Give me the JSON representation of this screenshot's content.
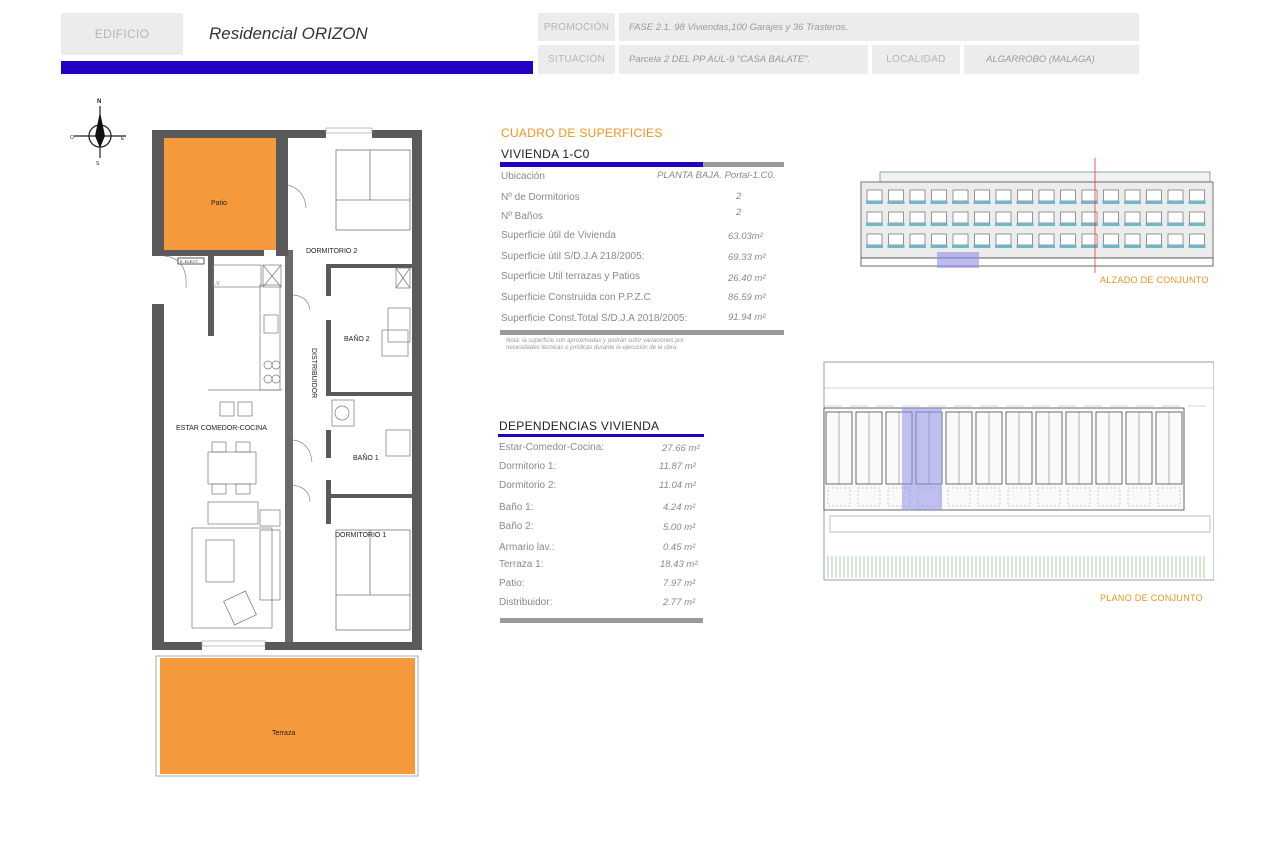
{
  "header": {
    "edificio_label": "EDIFICIO",
    "edificio_value": "Residencial ORIZON",
    "promocion_label": "PROMOCIÓN",
    "promocion_value": "FASE 2.1. 98 Viviendas,100 Garajes y 36 Trasteros.",
    "situacion_label": "SITUACIÓN",
    "situacion_value": "Parcela 2 DEL PP AUL-9 \"CASA BALATE\".",
    "localidad_label": "LOCALIDAD",
    "localidad_value": "ALGARROBO (MALAGA)",
    "accent_color": "#2400c7"
  },
  "floorplan": {
    "rooms": {
      "patio": "Patio",
      "dormitorio2": "DORMITORIO 2",
      "e_elect": "E. ELECT.",
      "lv": "L.V.",
      "bano2": "BAÑO 2",
      "distribuidor": "DISTRIBUIDOR",
      "estar": "ESTAR COMEDOR-COCINA",
      "bano1": "BAÑO 1",
      "dormitorio1": "DORMITORIO 1",
      "terraza": "Terraza"
    },
    "compass": {
      "n": "N",
      "e": "E",
      "s": "S",
      "o": "O"
    },
    "patio_color": "#f59a3c",
    "wall_color": "#5a5a5a"
  },
  "superficies": {
    "title": "CUADRO DE SUPERFICIES",
    "subtitle": "VIVIENDA 1-C0",
    "rows": [
      {
        "label": "Ubicación",
        "value": "PLANTA BAJA. Portal-1.C0."
      },
      {
        "label": "Nº de Dormitorios",
        "value": "2"
      },
      {
        "label": "Nº Baños",
        "value": "2"
      },
      {
        "label": "Superficie útil de Vivienda",
        "value": "63.03m²"
      },
      {
        "label": "Superficie útil S/D.J.A 218/2005:",
        "value": "69.33 m²"
      },
      {
        "label": "Superficie Util terrazas y Patios",
        "value": "26.40 m²"
      },
      {
        "label": "Superficie Construida con P.P.Z.C",
        "value": "86.59 m²"
      },
      {
        "label": "Superficie Const.Total S/D.J.A 2018/2005:",
        "value": "91.94 m²"
      }
    ],
    "note_line1": "Nota: la superficie son aproximadas y podrán sufrir variaciones por",
    "note_line2": "necesidades técnicas o jurídicas durante la ejecución de la obra"
  },
  "dependencias": {
    "title": "DEPENDENCIAS VIVIENDA",
    "rows": [
      {
        "label": "Estar-Comedor-Cocina:",
        "value": "27.66 m²"
      },
      {
        "label": "Dormitorio 1:",
        "value": "11.87 m²"
      },
      {
        "label": "Dormitorio 2:",
        "value": "11.04 m²"
      },
      {
        "label": "Baño 1:",
        "value": "4.24 m²"
      },
      {
        "label": "Baño 2:",
        "value": "5.00 m²"
      },
      {
        "label": "Armario lav.:",
        "value": "0.45 m²"
      },
      {
        "label": "Terraza 1:",
        "value": "18.43 m²"
      },
      {
        "label": "Patio:",
        "value": "7.97 m²"
      },
      {
        "label": "Distribuidor:",
        "value": "2.77 m²"
      }
    ]
  },
  "alzado_label": "ALZADO DE CONJUNTO",
  "plano_label": "PLANO DE CONJUNTO"
}
